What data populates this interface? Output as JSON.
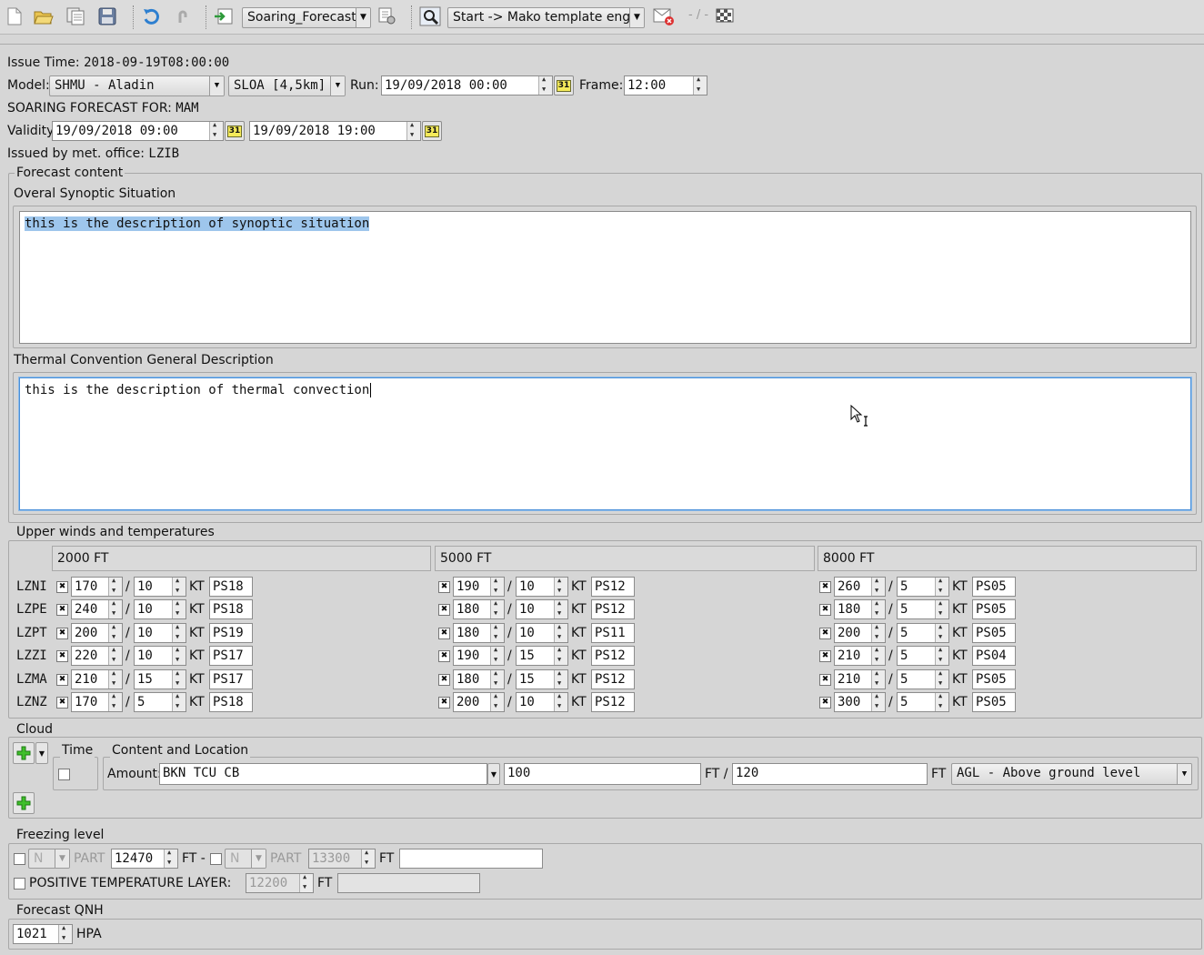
{
  "toolbar": {
    "icons": [
      "new-file-icon",
      "open-folder-icon",
      "copy-icon",
      "save-icon",
      "undo-icon",
      "redo-icon",
      "export-icon",
      "settings-icon",
      "preview-icon",
      "send-mail-icon",
      "checkered-flag-icon"
    ],
    "template_combo": "Soaring_Forecast",
    "engine_combo": "Start -> Mako template engine",
    "separator_text": "- / -"
  },
  "header": {
    "issue_time_label": "Issue Time:",
    "issue_time_value": "2018-09-19T08:00:00",
    "model_label": "Model:",
    "model_value": "SHMU - Aladin",
    "grid_value": "SLOA [4,5km]",
    "run_label": "Run:",
    "run_value": "19/09/2018 00:00",
    "frame_label": "Frame:",
    "frame_value": "12:00",
    "for_label": "SOARING FORECAST FOR:",
    "for_value": "MAM",
    "validity_label": "Validity",
    "validity_from": "19/09/2018 09:00",
    "validity_to": "19/09/2018 19:00",
    "issued_by_label": "Issued by met. office:",
    "issued_by_value": "LZIB",
    "calendar_glyph": "31"
  },
  "forecast_content": {
    "title": "Forecast content",
    "synoptic_label": "Overal Synoptic Situation",
    "synoptic_text": "this is the description of synoptic situation",
    "thermal_label": "Thermal Convention General Description",
    "thermal_text": "this is the description of thermal convection"
  },
  "upper_winds": {
    "title": "Upper winds and temperatures",
    "columns": [
      "2000 FT",
      "5000 FT",
      "8000 FT"
    ],
    "separator": "/",
    "unit": "KT",
    "rows": [
      {
        "station": "LZNI",
        "cells": [
          [
            "170",
            "10",
            "PS18"
          ],
          [
            "190",
            "10",
            "PS12"
          ],
          [
            "260",
            "5",
            "PS05"
          ]
        ]
      },
      {
        "station": "LZPE",
        "cells": [
          [
            "240",
            "10",
            "PS18"
          ],
          [
            "180",
            "10",
            "PS12"
          ],
          [
            "180",
            "5",
            "PS05"
          ]
        ]
      },
      {
        "station": "LZPT",
        "cells": [
          [
            "200",
            "10",
            "PS19"
          ],
          [
            "180",
            "10",
            "PS11"
          ],
          [
            "200",
            "5",
            "PS05"
          ]
        ]
      },
      {
        "station": "LZZI",
        "cells": [
          [
            "220",
            "10",
            "PS17"
          ],
          [
            "190",
            "15",
            "PS12"
          ],
          [
            "210",
            "5",
            "PS04"
          ]
        ]
      },
      {
        "station": "LZMA",
        "cells": [
          [
            "210",
            "15",
            "PS17"
          ],
          [
            "180",
            "15",
            "PS12"
          ],
          [
            "210",
            "5",
            "PS05"
          ]
        ]
      },
      {
        "station": "LZNZ",
        "cells": [
          [
            "170",
            "5",
            "PS18"
          ],
          [
            "200",
            "10",
            "PS12"
          ],
          [
            "300",
            "5",
            "PS05"
          ]
        ]
      }
    ]
  },
  "cloud": {
    "title": "Cloud",
    "time_label": "Time",
    "content_label": "Content and Location",
    "amount_label": "Amount:",
    "amount_value": "BKN TCU CB",
    "base_value": "100",
    "base_unit": "FT /",
    "top_value": "120",
    "top_unit": "FT",
    "reference_value": "AGL - Above ground level"
  },
  "freezing": {
    "title": "Freezing level",
    "n1": "N",
    "part1_label": "PART",
    "part1_value": "12470",
    "ft_dash": "FT -",
    "n2": "N",
    "part2_label": "PART",
    "part2_value": "13300",
    "ft": "FT",
    "positive_label": "POSITIVE TEMPERATURE LAYER:",
    "positive_value": "12200",
    "positive_ft": "FT"
  },
  "qnh": {
    "title": "Forecast QNH",
    "value": "1021",
    "unit": "HPA"
  }
}
